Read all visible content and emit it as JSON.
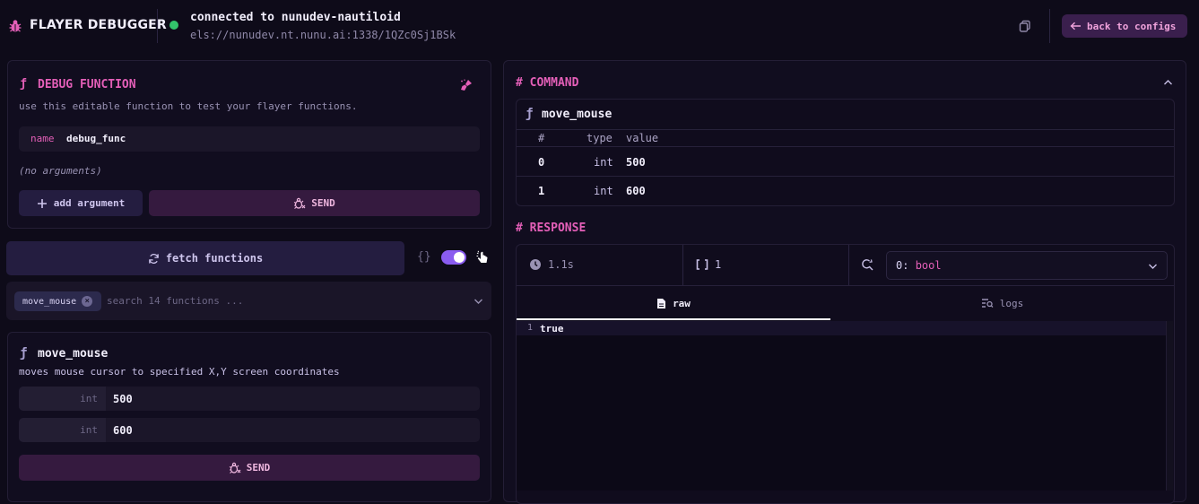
{
  "header": {
    "app_title": "FLAYER DEBUGGER",
    "connection_title": "connected to nunudev-nautiloid",
    "connection_url": "els://nunudev.nt.nunu.ai:1338/1QZc0Sj1BSk",
    "back_label": "back to configs"
  },
  "debug_function": {
    "title": "DEBUG FUNCTION",
    "description": "use this editable function to test your flayer functions.",
    "name_label": "name",
    "name_value": "debug_func",
    "no_args": "(no arguments)",
    "add_argument_label": "add argument",
    "send_label": "SEND"
  },
  "functions": {
    "fetch_label": "fetch functions",
    "braces": "{}",
    "selected_chip": "move_mouse",
    "search_placeholder": "search 14 functions ..."
  },
  "selected_function": {
    "name": "move_mouse",
    "description": "moves mouse cursor to specified X,Y screen coordinates",
    "args": [
      {
        "type": "int",
        "value": "500"
      },
      {
        "type": "int",
        "value": "600"
      }
    ],
    "send_label": "SEND"
  },
  "command": {
    "title": "# COMMAND",
    "function_name": "move_mouse",
    "columns": [
      "#",
      "type",
      "value"
    ],
    "rows": [
      {
        "index": "0",
        "type": "int",
        "value": "500"
      },
      {
        "index": "1",
        "type": "int",
        "value": "600"
      }
    ]
  },
  "response": {
    "title": "# RESPONSE",
    "duration": "1.1s",
    "count": "1",
    "selected_result": "0: bool",
    "tabs": [
      {
        "label": "raw",
        "active": true
      },
      {
        "label": "logs",
        "active": false
      }
    ],
    "lines": [
      {
        "number": "1",
        "text": "true"
      }
    ]
  },
  "colors": {
    "accent_pink": "#e45fb8",
    "accent_purple": "#8a5cf0",
    "status_green": "#33c36b",
    "background": "#0e0b19"
  },
  "icons": [
    "bug-icon",
    "copy-icon",
    "arrow-left-icon",
    "function-icon",
    "paint-brush-icon",
    "plus-icon",
    "bug-send-icon",
    "refresh-icon",
    "cursor-pointer-icon",
    "chevron-down-icon",
    "chevron-up-icon",
    "clock-icon",
    "brackets-icon",
    "search-refresh-icon",
    "file-icon",
    "list-search-icon"
  ]
}
